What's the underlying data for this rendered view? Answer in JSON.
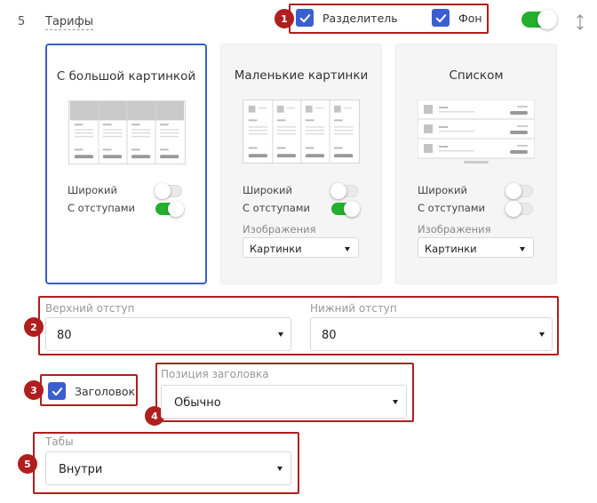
{
  "section": {
    "number": "5",
    "title": "Тарифы"
  },
  "header": {
    "divider_label": "Разделитель",
    "background_label": "Фон",
    "divider_checked": true,
    "background_checked": true,
    "visible_toggle_on": true
  },
  "callouts": [
    "1",
    "2",
    "3",
    "4",
    "5"
  ],
  "cards": [
    {
      "title": "С большой картинкой",
      "wide_label": "Широкий",
      "padding_label": "С отступами",
      "wide_on": false,
      "padding_on": true,
      "selected": true
    },
    {
      "title": "Маленькие картинки",
      "wide_label": "Широкий",
      "padding_label": "С отступами",
      "images_label": "Изображения",
      "images_value": "Картинки",
      "wide_on": false,
      "padding_on": true,
      "selected": false
    },
    {
      "title": "Списком",
      "wide_label": "Широкий",
      "padding_label": "С отступами",
      "images_label": "Изображения",
      "images_value": "Картинки",
      "wide_on": false,
      "padding_on": false,
      "selected": false
    }
  ],
  "spacing": {
    "top_label": "Верхний отступ",
    "top_value": "80",
    "bottom_label": "Нижний отступ",
    "bottom_value": "80"
  },
  "heading": {
    "checkbox_label": "Заголовок",
    "checked": true,
    "position_label": "Позиция заголовка",
    "position_value": "Обычно"
  },
  "tabs": {
    "label": "Табы",
    "value": "Внутри"
  },
  "colors": {
    "accent": "#3b5fd0",
    "callout": "#b01e1e",
    "toggle_on": "#22b02e",
    "selected_border": "#3760c4"
  }
}
